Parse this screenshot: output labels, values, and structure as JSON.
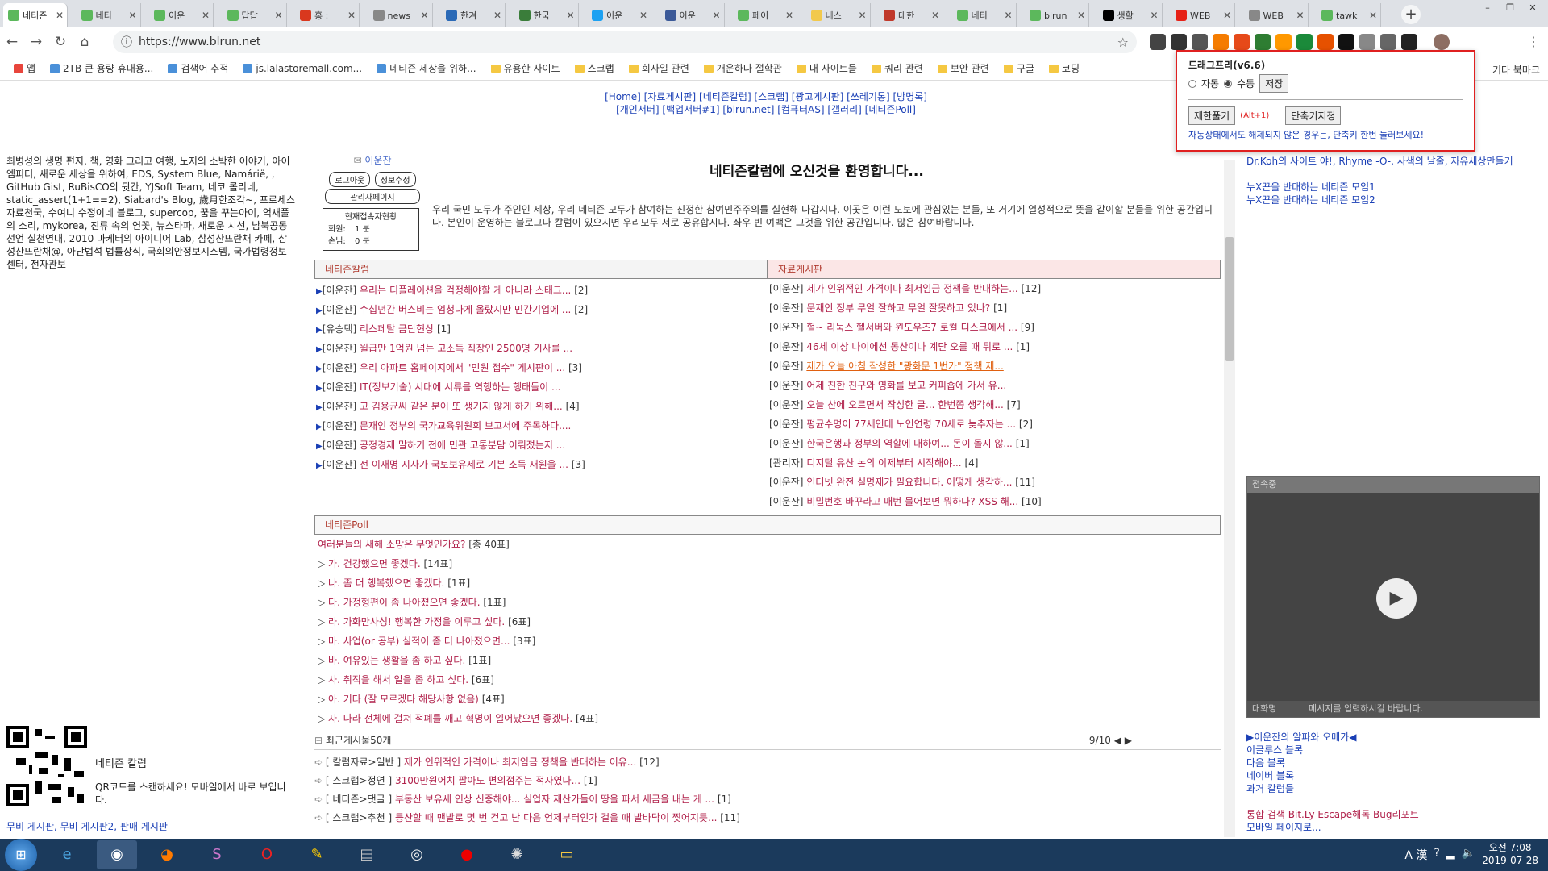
{
  "tabs": [
    {
      "title": "네티즌",
      "color": "#5cb85c",
      "active": true
    },
    {
      "title": "네티",
      "color": "#5cb85c"
    },
    {
      "title": "이운",
      "color": "#5cb85c"
    },
    {
      "title": "답답",
      "color": "#5cb85c"
    },
    {
      "title": "홍 :",
      "color": "#d9381e"
    },
    {
      "title": "news",
      "color": "#888"
    },
    {
      "title": "한겨",
      "color": "#2b6ab7"
    },
    {
      "title": "한국",
      "color": "#3a7d3a"
    },
    {
      "title": "이운",
      "color": "#1da1f2"
    },
    {
      "title": "이운",
      "color": "#3b5998"
    },
    {
      "title": "페이",
      "color": "#5cb85c"
    },
    {
      "title": "내스",
      "color": "#f2c94c"
    },
    {
      "title": "대한",
      "color": "#c0392b"
    },
    {
      "title": "네티",
      "color": "#5cb85c"
    },
    {
      "title": "blrun",
      "color": "#5cb85c"
    },
    {
      "title": "생활",
      "color": "#000"
    },
    {
      "title": "WEB",
      "color": "#e62117"
    },
    {
      "title": "WEB",
      "color": "#888"
    },
    {
      "title": "tawk",
      "color": "#5cb85c"
    }
  ],
  "url": "https://www.blrun.net",
  "bookmarks": [
    "앱",
    "2TB 큰 용량 휴대용...",
    "검색어 추적",
    "js.lalastoremall.com...",
    "네티즌 세상을 위하...",
    "유용한 사이트",
    "스크랩",
    "회사일 관련",
    "개운하다 절학관",
    "내 사이트들",
    "쿼리 관련",
    "보안 관련",
    "구글",
    "코딩"
  ],
  "bookmarks_other": "기타 북마크",
  "topnav": {
    "line1": "[Home] [자료게시판] [네티즌칼럼] [스크랩] [광고게시판] [쓰레기통] [방명록]",
    "line2": "[개인서버] [백업서버#1] [blrun.net] [컴퓨터AS] [갤러리] [네티즌Poll]"
  },
  "left_links": "최병성의 생명 편지, 책, 영화 그리고 여행, 노지의 소박한 이야기, 아이엠피터, 새로운 세상을 위하여, EDS, System Blue, Namárië, , GitHub Gist, RuBisCO의 뒷간, YJSoft Team, 네코 롤리네, static_assert(1+1==2), Siabard's Blog, 歲月한조각~, 프로세스 자료천국, 수여니 수정이네 블로그, supercop, 꿈을 꾸는아이, 억새풀의 소리, mykorea, 진류 속의 연꽃, 뉴스타파, 새로운 시선, 남북공동선언 실천연대, 2010 마케터의 아이디어 Lab, 삼성산뜨란채 카페, 삼성산뜨란채@, 아단법석 법률상식, 국회의안정보시스템, 국가법령정보센터, 전자관보",
  "qr": {
    "title": "네티즌 칼럼",
    "desc": "QR코드를 스캔하세요! 모바일에서 바로 보입니다."
  },
  "left_bottom": "무비 게시판, 무비 게시판2, 판매 게시판",
  "user": {
    "name": "이운잔",
    "logout": "로그아웃",
    "edit": "정보수정",
    "admin": "관리자페이지",
    "status_title": "현재접속자현황",
    "member_label": "회원:",
    "member_count": "1 분",
    "guest_label": "손님:",
    "guest_count": "0 분"
  },
  "welcome": "네티즌칼럼에 오신것을 환영합니다...",
  "intro": "우리 국민 모두가 주인인 세상, 우리 네티즌 모두가 참여하는 진정한 참여민주주의를 실현해 나갑시다. 이곳은 이런 모토에 관심있는 분들, 또 거기에 열성적으로 뜻을 같이할 분들을 위한 공간입니다. 본인이 운영하는 블로그나 칼럼이 있으시면 우리모두 서로 공유합시다. 좌우 빈 여백은 그것을 위한 공간입니다. 많은 참여바랍니다.",
  "column_board": {
    "title": "네티즌칼럼",
    "rows": [
      {
        "author": "[이운잔]",
        "title": "우리는 디플레이션을 걱정해야할 게 아니라 스태그...",
        "count": "[2]"
      },
      {
        "author": "[이운잔]",
        "title": "수십년간 버스비는 엄청나게 올랐지만 민간기업에 ...",
        "count": "[2]"
      },
      {
        "author": "[유승택]",
        "title": "리스페탈 금단현상",
        "count": "[1]"
      },
      {
        "author": "[이운잔]",
        "title": "월급만 1억원 넘는 고소득 직장인 2500명 기사를 ...",
        "count": ""
      },
      {
        "author": "[이운잔]",
        "title": "우리 아파트 홈페이지에서 \"민원 접수\" 게시판이 ...",
        "count": "[3]"
      },
      {
        "author": "[이운잔]",
        "title": "IT(정보기술) 시대에 시류를 역행하는 행태들이 ...",
        "count": ""
      },
      {
        "author": "[이운잔]",
        "title": "고 김용균씨 같은 분이 또 생기지 않게 하기 위해...",
        "count": "[4]"
      },
      {
        "author": "[이운잔]",
        "title": "문재인 정부의 국가교육위원회 보고서에 주목하다....",
        "count": ""
      },
      {
        "author": "[이운잔]",
        "title": "공정경제 말하기 전에 민관 고통분담 이뤄졌는지 ...",
        "count": ""
      },
      {
        "author": "[이운잔]",
        "title": "전 이재명 지사가 국토보유세로 기본 소득 재원을 ...",
        "count": "[3]"
      }
    ]
  },
  "data_board": {
    "title": "자료게시판",
    "rows": [
      {
        "author": "[이운잔]",
        "title": "제가 인위적인 가격이나 최저임금 정책을 반대하는...",
        "count": "[12]"
      },
      {
        "author": "[이운잔]",
        "title": "문재인 정부 무얼 잘하고 무얼 잘못하고 있나?",
        "count": "[1]"
      },
      {
        "author": "[이운잔]",
        "title": "헐~ 리눅스 헬서버와 윈도우즈7 로컬 디스크에서 ...",
        "count": "[9]"
      },
      {
        "author": "[이운잔]",
        "title": "46세 이상 나이에선 동산이나 계단 오를 때 뒤로 ...",
        "count": "[1]"
      },
      {
        "author": "[이운잔]",
        "title": "제가 오늘 아침 작성한 \"광화문 1번가\" 정책 제...",
        "count": "",
        "hl": true
      },
      {
        "author": "[이운잔]",
        "title": "어제 친한 친구와 영화를 보고 커피숍에 가서 유...",
        "count": ""
      },
      {
        "author": "[이운잔]",
        "title": "오늘 산에 오르면서 작성한 글... 한번쯤 생각해...",
        "count": "[7]"
      },
      {
        "author": "[이운잔]",
        "title": "평균수명이 77세인데 노인연령 70세로 늦추자는 ...",
        "count": "[2]"
      },
      {
        "author": "[이운잔]",
        "title": "한국은행과 정부의 역할에 대하여... 돈이 돌지 않...",
        "count": "[1]"
      },
      {
        "author": "[관리자]",
        "title": "디지털 유산 논의 이제부터 시작해야...",
        "count": "[4]"
      },
      {
        "author": "[이운잔]",
        "title": "인터넷 완전 실명제가 필요합니다. 어떻게 생각하...",
        "count": "[11]"
      },
      {
        "author": "[이운잔]",
        "title": "비밀번호 바꾸라고 매번 물어보면 뭐하나? XSS 해...",
        "count": "[10]"
      }
    ]
  },
  "poll": {
    "title": "네티즌Poll",
    "question": "여러분들의 새해 소망은 무엇인가요?",
    "total": "[총 40표]",
    "options": [
      {
        "text": "가. 건강했으면 좋겠다.",
        "votes": "[14표]"
      },
      {
        "text": "나. 좀 더 행복했으면 좋겠다.",
        "votes": "[1표]"
      },
      {
        "text": "다. 가정형편이 좀 나아졌으면 좋겠다.",
        "votes": "[1표]"
      },
      {
        "text": "라. 가화만사성! 행복한 가정을 이루고 싶다.",
        "votes": "[6표]"
      },
      {
        "text": "마. 사업(or 공부) 실적이 좀 더 나아졌으면...",
        "votes": "[3표]"
      },
      {
        "text": "바. 여유있는 생활을 좀 하고 싶다.",
        "votes": "[1표]"
      },
      {
        "text": "사. 취직을 해서 일을 좀 하고 싶다.",
        "votes": "[6표]"
      },
      {
        "text": "아. 기타 (잘 모르겠다 해당사항 없음)",
        "votes": "[4표]"
      },
      {
        "text": "자. 나라 전체에 걸쳐 적폐를 깨고 혁명이 일어났으면 좋겠다.",
        "votes": "[4표]"
      }
    ]
  },
  "recent": {
    "title": "최근게시물50개",
    "page": "9/10",
    "rows": [
      {
        "cat": "[ 칼럼자료>일반 ]",
        "title": "제가 인위적인 가격이나 최저임금 정책을 반대하는 이유...",
        "count": "[12]"
      },
      {
        "cat": "[ 스크랩>정연 ]",
        "title": "3100만원어치 팔아도 편의점주는 적자였다...",
        "count": "[1]"
      },
      {
        "cat": "[ 네티즌>댓글 ]",
        "title": "부동산 보유세 인상 신중해야... 실업자 재산가들이 땅을 파서 세금을 내는 게 ...",
        "count": "[1]"
      },
      {
        "cat": "[ 스크랩>추천 ]",
        "title": "등산할 때 맨발로 몇 번 걷고 난 다음 언제부터인가 걸을 때 발바닥이 찢어지듯...",
        "count": "[11]"
      }
    ]
  },
  "right_links": {
    "line1": "Dr.Koh의 사이트 야!, Rhyme -O-, 사색의 날줄, 자유세상만들기",
    "line2": "누X끈을 반대하는 네티즌 모임1",
    "line3": "누X끈을 반대하는 네티즌 모임2"
  },
  "chat": {
    "head": "접속중",
    "nick": "대화명",
    "placeholder": "메시지를 입력하시길 바랍니다."
  },
  "right_bottom": [
    "▶이운잔의 알파와 오메가◀",
    "이글루스 블록",
    "다음 블록",
    "네이버 블록",
    "과거 칼럼들",
    "",
    "통합 검색 Bit.Ly Escape해독 Bug리포트",
    "모바일 페이지로..."
  ],
  "popup": {
    "title": "드래그프리(v6.6)",
    "auto": "자동",
    "manual": "수동",
    "save": "저장",
    "unlock": "제한풀기",
    "hotkey": "(Alt+1)",
    "set_hotkey": "단축키지정",
    "note": "자동상태에서도 해제되지 않은 경우는, 단축키 한번 눌러보세요!"
  },
  "clock": {
    "time": "오전 7:08",
    "date": "2019-07-28"
  },
  "tray": "A 漢"
}
